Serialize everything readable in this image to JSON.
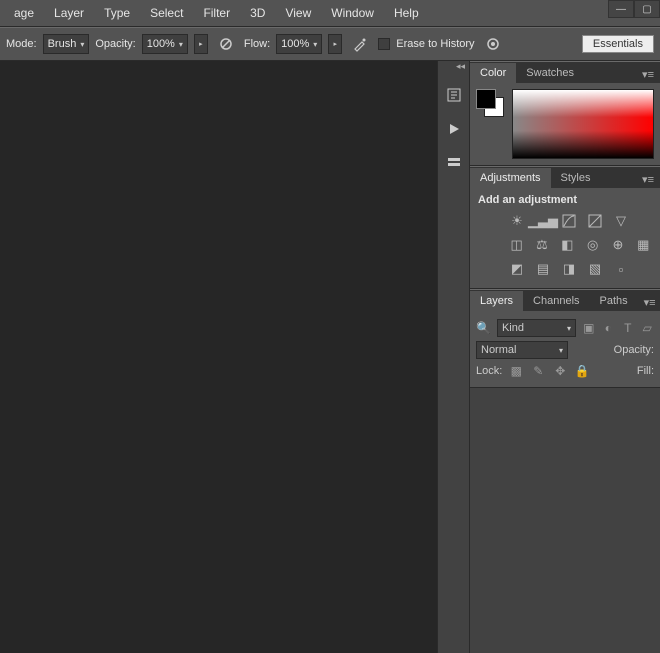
{
  "menubar": [
    "age",
    "Layer",
    "Type",
    "Select",
    "Filter",
    "3D",
    "View",
    "Window",
    "Help"
  ],
  "optionsbar": {
    "mode_label": "Mode:",
    "mode_value": "Brush",
    "opacity_label": "Opacity:",
    "opacity_value": "100%",
    "flow_label": "Flow:",
    "flow_value": "100%",
    "erase_history_label": "Erase to History",
    "workspace_button": "Essentials"
  },
  "panels": {
    "color": {
      "tab_color": "Color",
      "tab_swatches": "Swatches"
    },
    "adjustments": {
      "tab_adjustments": "Adjustments",
      "tab_styles": "Styles",
      "heading": "Add an adjustment"
    },
    "layers": {
      "tab_layers": "Layers",
      "tab_channels": "Channels",
      "tab_paths": "Paths",
      "kind_label": "Kind",
      "blend_mode": "Normal",
      "opacity_label": "Opacity:",
      "lock_label": "Lock:",
      "fill_label": "Fill:"
    }
  }
}
